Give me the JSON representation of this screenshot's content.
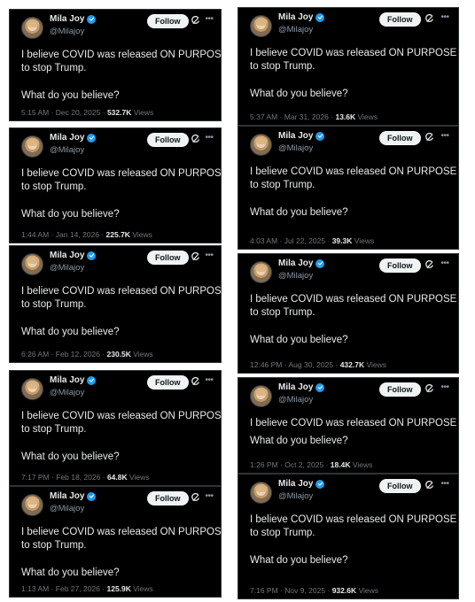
{
  "tweets_left": [
    {
      "name": "Mila Joy",
      "handle": "@Milajoy",
      "follow": "Follow",
      "line1": "I believe COVID was released ON PURPOSE",
      "line2": "to stop Trump.",
      "line3": "What do you believe?",
      "time": "5:15 AM",
      "date": "Dec 20, 2025",
      "views_count": "532.7K",
      "views_label": "Views"
    },
    {
      "name": "Mila Joy",
      "handle": "@Milajoy",
      "follow": "Follow",
      "line1": "I believe COVID was released ON PURPOSE",
      "line2": "to stop Trump.",
      "line3": "What do you believe?",
      "time": "1:44 AM",
      "date": "Jan 14, 2026",
      "views_count": "225.7K",
      "views_label": "Views"
    },
    {
      "name": "Mila Joy",
      "handle": "@Milajoy",
      "follow": "Follow",
      "line1": "I believe COVID was released ON PURPOSE",
      "line2": "to stop Trump.",
      "line3": "What do you believe?",
      "time": "6:26 AM",
      "date": "Feb 12, 2026",
      "views_count": "230.5K",
      "views_label": "Views"
    },
    {
      "name": "Mila Joy",
      "handle": "@Milajoy",
      "follow": "Follow",
      "line1": "I believe COVID was released ON PURPOSE",
      "line2": "to stop Trump.",
      "line3": "What do you believe?",
      "time": "7:17 PM",
      "date": "Feb 18, 2026",
      "views_count": "64.8K",
      "views_label": "Views"
    },
    {
      "name": "Mila Joy",
      "handle": "@Milajoy",
      "follow": "Follow",
      "line1": "I believe COVID was released ON PURPOSE",
      "line2": "to stop Trump.",
      "line3": "What do you believe?",
      "time": "1:13 AM",
      "date": "Feb 27, 2026",
      "views_count": "125.9K",
      "views_label": "Views"
    }
  ],
  "tweets_right": [
    {
      "name": "Mila Joy",
      "handle": "@Milajoy",
      "follow": "Follow",
      "line1": "I believe COVID was released ON PURPOSE",
      "line2": "to stop Trump.",
      "line3": "What do you believe?",
      "time": "5:37 AM",
      "date": "Mar 31, 2026",
      "views_count": "13.6K",
      "views_label": "Views"
    },
    {
      "name": "Mila Joy",
      "handle": "@Milajoy",
      "follow": "Follow",
      "line1": "I believe COVID was released ON PURPOSE",
      "line2": "to stop Trump.",
      "line3": "What do you believe?",
      "time": "4:03 AM",
      "date": "Jul 22, 2025",
      "views_count": "39.3K",
      "views_label": "Views"
    },
    {
      "name": "Mila Joy",
      "handle": "@Milajoy",
      "follow": "Follow",
      "line1": "I believe COVID was released ON PURPOSE",
      "line2": "to stop Trump.",
      "line3": "What do you believe?",
      "time": "12:46 PM",
      "date": "Aug 30, 2025",
      "views_count": "432.7K",
      "views_label": "Views"
    },
    {
      "name": "Mila Joy",
      "handle": "@Milajoy",
      "follow": "Follow",
      "line1": "I believe COVID was released ON PURPOSE",
      "line2": "",
      "line3": "What do you believe?",
      "time": "1:26 PM",
      "date": "Oct 2, 2025",
      "views_count": "18.4K",
      "views_label": "Views"
    },
    {
      "name": "Mila Joy",
      "handle": "@Milajoy",
      "follow": "Follow",
      "line1": "I believe COVID was released ON PURPOSE",
      "line2": "to stop Trump.",
      "line3": "What do you believe?",
      "time": "7:16 PM",
      "date": "Nov 9, 2025",
      "views_count": "932.6K",
      "views_label": "Views"
    }
  ],
  "meta_separator": "·",
  "colors": {
    "background": "#000000",
    "text": "#e7e9ea",
    "muted": "#71767b",
    "verified": "#1d9bf0",
    "follow_bg": "#eff3f4"
  },
  "icons": {
    "verified": "verified-badge-icon",
    "grok": "grok-icon",
    "more": "more-icon"
  }
}
